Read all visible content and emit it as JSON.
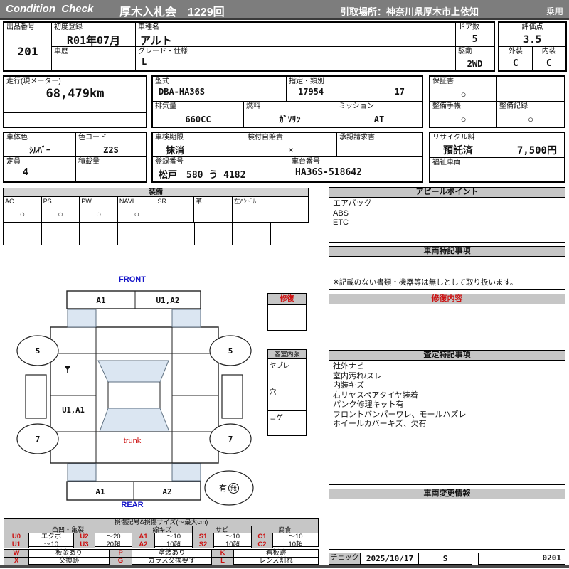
{
  "header": {
    "brand": "Condition  Check",
    "auction": "厚木入札会　1229回",
    "pickup": "引取場所：神奈川県厚木市上依知",
    "category": "乗用"
  },
  "t1": {
    "lot_l": "出品番号",
    "lot": "201",
    "reg_l": "初度登録",
    "reg": "R01年07月",
    "name_l": "車種名",
    "name": "アルト",
    "doors_l": "ドア数",
    "doors": "5",
    "hist_l": "車歴",
    "hist": "",
    "grade_l": "グレード・仕様",
    "grade": "L",
    "drive_l": "駆動",
    "drive": "2WD",
    "score_l": "評価点",
    "score": "3.5",
    "ext_l": "外装",
    "ext": "C",
    "int_l": "内装",
    "int": "C"
  },
  "t2": {
    "mil_l": "走行(現メーター)",
    "mil": "68,479km",
    "model_l": "型式",
    "model": "DBA-HA36S",
    "class_l": "指定・類別",
    "class1": "17954",
    "class2": "17",
    "war_l": "保証書",
    "war": "○",
    "disp_l": "排気量",
    "disp": "660CC",
    "fuel_l": "燃料",
    "fuel": "ｶﾞｿﾘﾝ",
    "mis_l": "ミッション",
    "mis": "AT",
    "book_l": "整備手帳",
    "book": "○",
    "rec_l": "整備記録",
    "rec": "○"
  },
  "t3": {
    "color_l": "車体色",
    "color": "ｼﾙﾊﾞｰ",
    "ccode_l": "色コード",
    "ccode": "Z2S",
    "insp_l": "車検期限",
    "insp": "抹消",
    "ins_l": "検付自賠責",
    "ins": "×",
    "appr_l": "承認請求書",
    "appr": "",
    "recy_l": "リサイクル料",
    "recy_s": "預託済",
    "recy_v": "7,500円",
    "cap_l": "定員",
    "cap": "4",
    "load_l": "積載量",
    "load": "",
    "regno_l": "登録番号",
    "regno": "松戸　580 う 4182",
    "chassis_l": "車台番号",
    "chassis": "HA36S-518642",
    "wel_l": "福祉車両",
    "wel": ""
  },
  "equipment": {
    "title": "装備",
    "items": [
      {
        "label": "AC",
        "value": "○"
      },
      {
        "label": "PS",
        "value": "○"
      },
      {
        "label": "PW",
        "value": "○"
      },
      {
        "label": "NAVI",
        "value": "○"
      },
      {
        "label": "SR",
        "value": ""
      },
      {
        "label": "革",
        "value": ""
      },
      {
        "label": "左ﾊﾝﾄﾞﾙ",
        "value": ""
      },
      {
        "label": "",
        "value": ""
      }
    ]
  },
  "appeal": {
    "title": "アピールポイント",
    "line0": "エアバッグ",
    "line1": "ABS",
    "line2": "ETC"
  },
  "vehicle_notes": {
    "title": "車両特記事項",
    "note": "※記載のない書類・機器等は無しとして取り扱います。"
  },
  "repair_detail": {
    "title": "修復内容"
  },
  "assessment": {
    "title": "査定特記事項",
    "line0": "社外ナビ",
    "line1": "室内汚れ/スレ",
    "line2": "内装キズ",
    "line3": "右リヤスペアタイヤ装着",
    "line4": "パンク修理キット有",
    "line5": "フロントバンパーワレ、モールハズレ",
    "line6": "ホイールカバーキズ、欠有"
  },
  "changes": {
    "title": "車両変更情報"
  },
  "check": {
    "label": "チェック",
    "date": "2025/10/17",
    "inspector": "S",
    "code": "0201"
  },
  "diagram": {
    "front": "FRONT",
    "rear": "REAR",
    "fb_left": "A1",
    "fb_right": "U1,A2",
    "left_door": "U1,A1",
    "trunk": "trunk",
    "wheel_fl": "5",
    "wheel_fr": "5",
    "wheel_rl": "7",
    "wheel_rr": "7",
    "rb_left": "A1",
    "rb_right": "A2",
    "spare_yes": "有",
    "spare_no": "無",
    "repair_title": "修復",
    "cabin_title": "客室内張",
    "cabin_row0": "ヤブレ",
    "cabin_row1": "穴",
    "cabin_row2": "コゲ"
  },
  "legend": {
    "title": "損傷記号&損傷サイズ(～最大cm)",
    "g0": "凸凹・亀裂",
    "g1": "線キズ",
    "g2": "サビ",
    "g3": "腐食",
    "r0": {
      "c0": "U0",
      "d0": "エクボ",
      "c1": "U2",
      "d1": "～20",
      "c2": "A1",
      "d2": "～10",
      "c3": "S1",
      "d3": "～10",
      "c4": "C1",
      "d4": "～10"
    },
    "r1": {
      "c0": "U1",
      "d0": "～10",
      "c1": "U3",
      "d1": "20超",
      "c2": "A2",
      "d2": "10超",
      "c3": "S2",
      "d3": "10超",
      "c4": "C2",
      "d4": "10超"
    },
    "x0": {
      "c0": "W",
      "d0": "板金あり",
      "c1": "P",
      "d1": "塗装あり",
      "c2": "K",
      "d2": "看板跡"
    },
    "x1": {
      "c0": "X",
      "d0": "交換跡",
      "c1": "G",
      "d1": "ガラス交換要す",
      "c2": "L",
      "d2": "レンズ割れ"
    }
  }
}
